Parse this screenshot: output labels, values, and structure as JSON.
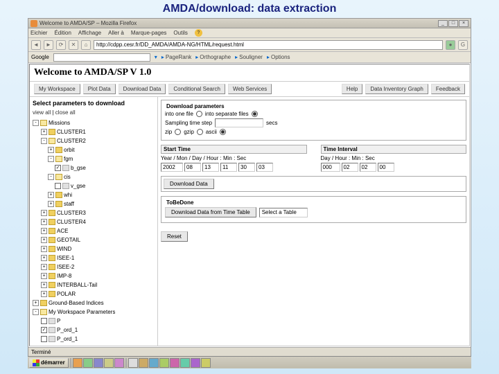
{
  "slide": {
    "title": "AMDA/download: data extraction"
  },
  "titlebar": {
    "text": "Welcome to AMDA/SP – Mozilla Firefox"
  },
  "menubar": [
    "Eichier",
    "Édition",
    "Affichage",
    "Aller à",
    "Marque-pages",
    "Outils"
  ],
  "nav": {
    "url": "http://cdpp.cesr.fr/DD_AMDA/AMDA-NG/HTML/request.html"
  },
  "gbar": {
    "label": "Google",
    "links": [
      "PageRank",
      "Orthographe",
      "Souligner",
      "Options"
    ]
  },
  "app": {
    "title": "Welcome to AMDA/SP V 1.0",
    "nav": [
      "My Workspace",
      "Plot Data",
      "Download Data",
      "Conditional Search",
      "Web Services"
    ],
    "nav_right": [
      "Help",
      "Data Inventory Graph",
      "Feedback"
    ]
  },
  "left": {
    "heading": "Select parameters to download",
    "links": {
      "view": "view all",
      "close": "close all"
    },
    "tree": {
      "missions": "Missions",
      "c1": "CLUSTER1",
      "c2": "CLUSTER2",
      "orbit": "orbit",
      "fgm": "fgm",
      "b_gse": "b_gse",
      "cis": "cis",
      "vcse": "v_gse",
      "whi": "whi",
      "staff": "staff",
      "c3": "CLUSTER3",
      "c4": "CLUSTER4",
      "ace": "ACE",
      "geotail": "GEOTAIL",
      "wind": "WIND",
      "isee1": "ISEE-1",
      "isee2": "ISEE-2",
      "imp8": "IMP-8",
      "interball": "INTERBALL-Tail",
      "polar": "POLAR",
      "gb": "Ground-Based Indices",
      "myws": "My Workspace Parameters",
      "p1": "P",
      "p2": "P_ord_1",
      "p3": "P_ord_1"
    }
  },
  "dp": {
    "legend": "Download parameters",
    "one": "into one file",
    "sep": "into separate files",
    "samp": "Sampling time step",
    "secs_unit": "secs",
    "zip": "zip",
    "gzip": "gzip",
    "ascii": "ascii"
  },
  "dt": {
    "start_hdr": "Start Time",
    "start_lbl": "Year / Mon / Day / Hour : Min : Sec",
    "y": "2002",
    "mo": "08",
    "d": "13",
    "h": "11",
    "mi": "30",
    "s": "03",
    "int_hdr": "Time Interval",
    "int_lbl": "Day / Hour : Min : Sec",
    "id": "000",
    "ih": "02",
    "im": "02",
    "is": "00"
  },
  "actions": {
    "download": "Download Data",
    "tbd_legend": "ToBeDone",
    "tbd_label": "Download Data from Time Table",
    "tbd_select": "Select a Table",
    "reset": "Reset"
  },
  "status": {
    "text": "Terminé"
  },
  "taskbar": {
    "start": "démarrer"
  }
}
